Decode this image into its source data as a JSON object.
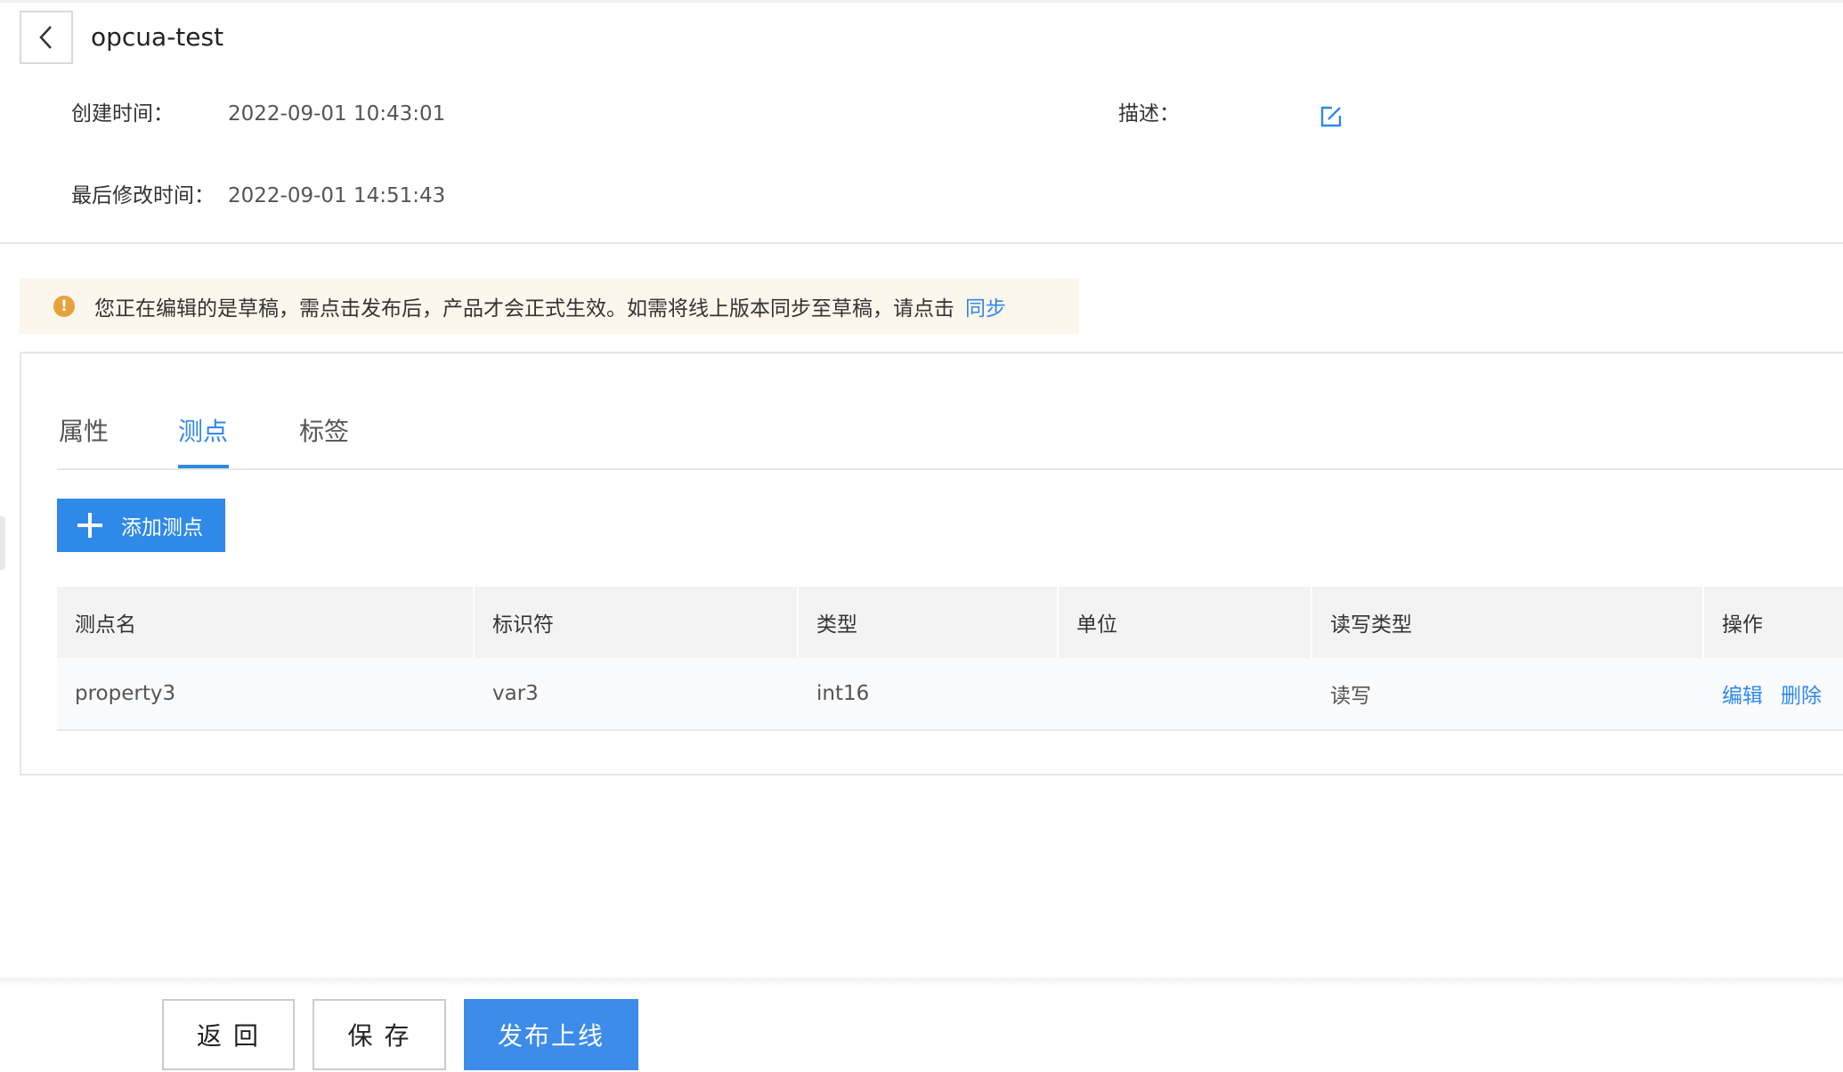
{
  "header": {
    "title": "opcua-test",
    "created_label": "创建时间：",
    "created_value": "2022-09-01 10:43:01",
    "modified_label": "最后修改时间：",
    "modified_value": "2022-09-01 14:51:43",
    "description_label": "描述："
  },
  "alert": {
    "icon": "!",
    "text": "您正在编辑的是草稿，需点击发布后，产品才会正式生效。如需将线上版本同步至草稿，请点击",
    "link": "同步"
  },
  "tabs": [
    {
      "label": "属性",
      "active": false
    },
    {
      "label": "测点",
      "active": true
    },
    {
      "label": "标签",
      "active": false
    }
  ],
  "add_button": "添加测点",
  "table": {
    "columns": [
      "测点名",
      "标识符",
      "类型",
      "单位",
      "读写类型",
      "操作"
    ],
    "rows": [
      {
        "name": "property3",
        "identifier": "var3",
        "type": "int16",
        "unit": "",
        "rw": "读写",
        "edit": "编辑",
        "delete": "删除"
      }
    ]
  },
  "footer": {
    "back": "返 回",
    "save": "保 存",
    "publish": "发布上线"
  },
  "colors": {
    "primary": "#2f89e9",
    "warning": "#e6a23c",
    "alert_bg": "#fdf6ec"
  }
}
